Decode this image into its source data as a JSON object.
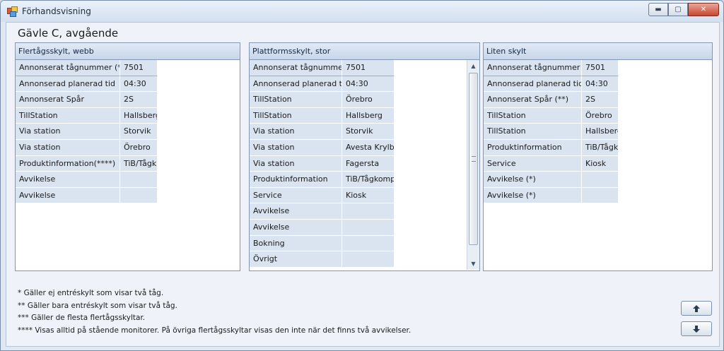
{
  "window": {
    "title": "Förhandsvisning",
    "min_glyph": "▬",
    "max_glyph": "▢",
    "close_glyph": "✕"
  },
  "heading": "Gävle C, avgående",
  "panels": [
    {
      "title": "Flertågsskylt, webb",
      "rows": [
        [
          "Annonserat tågnummer (***)",
          "7501"
        ],
        [
          "Annonserad planerad tid",
          "04:30"
        ],
        [
          "Annonserat Spår",
          "2S"
        ],
        [
          "TillStation",
          "Hallsberg"
        ],
        [
          "Via station",
          "Storvik"
        ],
        [
          "Via station",
          "Örebro"
        ],
        [
          "Produktinformation(****)",
          "TiB/Tågk"
        ],
        [
          "Avvikelse",
          ""
        ],
        [
          "Avvikelse",
          ""
        ]
      ]
    },
    {
      "title": "Plattformsskylt, stor",
      "rows": [
        [
          "Annonserat tågnummer",
          "7501"
        ],
        [
          "Annonserad planerad tid",
          "04:30"
        ],
        [
          "TillStation",
          "Örebro"
        ],
        [
          "TillStation",
          "Hallsberg"
        ],
        [
          "Via station",
          "Storvik"
        ],
        [
          "Via station",
          "Avesta Krylbo"
        ],
        [
          "Via station",
          "Fagersta"
        ],
        [
          "Produktinformation",
          "TiB/Tågkomp."
        ],
        [
          "Service",
          "Kiosk"
        ],
        [
          "Avvikelse",
          ""
        ],
        [
          "Avvikelse",
          ""
        ],
        [
          "Bokning",
          ""
        ],
        [
          "Övrigt",
          ""
        ]
      ]
    },
    {
      "title": "Liten skylt",
      "rows": [
        [
          "Annonserat tågnummer (*)",
          "7501"
        ],
        [
          "Annonserad planerad tid",
          "04:30"
        ],
        [
          "Annonserat Spår (**)",
          "2S"
        ],
        [
          "TillStation",
          "Örebro"
        ],
        [
          "TillStation",
          "Hallsberg"
        ],
        [
          "Produktinformation",
          "TiB/Tågk"
        ],
        [
          "Service",
          "Kiosk"
        ],
        [
          "Avvikelse (*)",
          ""
        ],
        [
          "Avvikelse (*)",
          ""
        ]
      ]
    }
  ],
  "footnotes": [
    "* Gäller ej entréskylt som visar två tåg.",
    "** Gäller bara entréskylt som visar två tåg.",
    "*** Gäller de flesta flertågsskyltar.",
    "**** Visas alltid på stående monitorer. På övriga flertågsskyltar visas den inte när det finns två avvikelser."
  ],
  "nav": {
    "up_icon": "arrow-up",
    "down_icon": "arrow-down"
  }
}
